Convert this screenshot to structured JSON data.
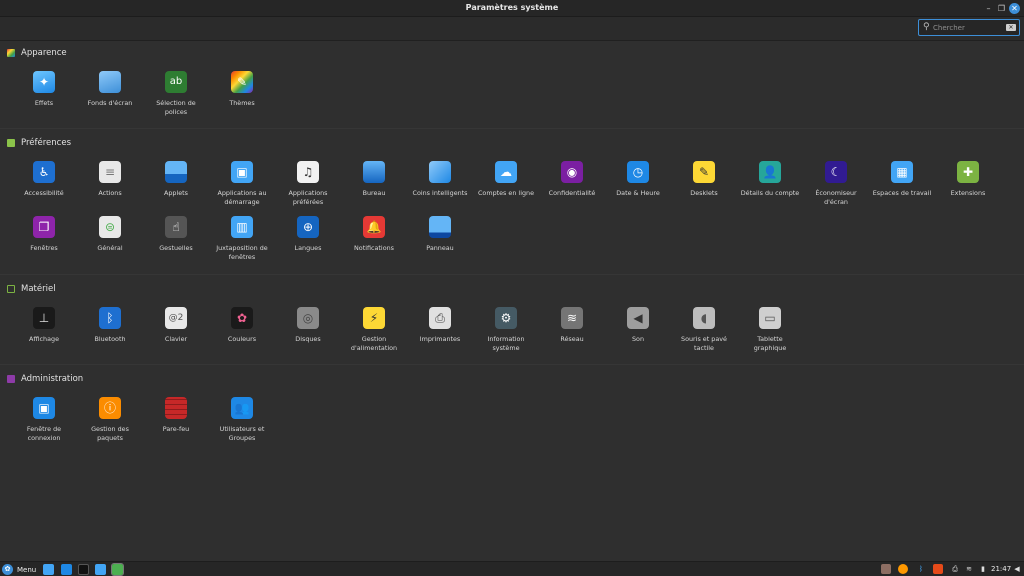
{
  "window": {
    "title": "Paramètres système"
  },
  "search": {
    "placeholder": "Chercher"
  },
  "sections": {
    "apparence": {
      "label": "Apparence",
      "color": "#c04ac8"
    },
    "preferences": {
      "label": "Préférences",
      "color": "#8bc34a"
    },
    "materiel": {
      "label": "Matériel",
      "color": "#7cb342"
    },
    "administration": {
      "label": "Administration",
      "color": "#8e3ba8"
    }
  },
  "items": {
    "effets": "Effets",
    "fonds": "Fonds d'écran",
    "polices": "Sélection de\npolices",
    "themes": "Thèmes",
    "accessibilite": "Accessibilité",
    "actions": "Actions",
    "applets": "Applets",
    "applications_demarrage": "Applications au\ndémarrage",
    "applications_preferees": "Applications\npréférées",
    "bureau": "Bureau",
    "coins": "Coins intelligents",
    "comptes": "Comptes en ligne",
    "confidentialite": "Confidentialité",
    "date": "Date & Heure",
    "desklets": "Desklets",
    "details_compte": "Détails du compte",
    "economiseur": "Économiseur\nd'écran",
    "espaces": "Espaces de travail",
    "extensions": "Extensions",
    "fenetres": "Fenêtres",
    "general": "Général",
    "gestuelles": "Gestuelles",
    "juxtaposition": "Juxtaposition de\nfenêtres",
    "langues": "Langues",
    "notifications": "Notifications",
    "panneau": "Panneau",
    "affichage": "Affichage",
    "bluetooth": "Bluetooth",
    "clavier": "Clavier",
    "couleurs": "Couleurs",
    "disques": "Disques",
    "gestion_alimentation": "Gestion\nd'alimentation",
    "imprimantes": "Imprimantes",
    "information_systeme": "Information\nsystème",
    "reseau": "Réseau",
    "son": "Son",
    "souris": "Souris et pavé\ntactile",
    "tablette": "Tablette\ngraphique",
    "fenetre_connexion": "Fenêtre de\nconnexion",
    "gestion_paquets": "Gestion des\npaquets",
    "parefeu": "Pare-feu",
    "utilisateurs": "Utilisateurs et\nGroupes"
  },
  "taskbar": {
    "menu_label": "Menu",
    "clock": "21:47"
  }
}
